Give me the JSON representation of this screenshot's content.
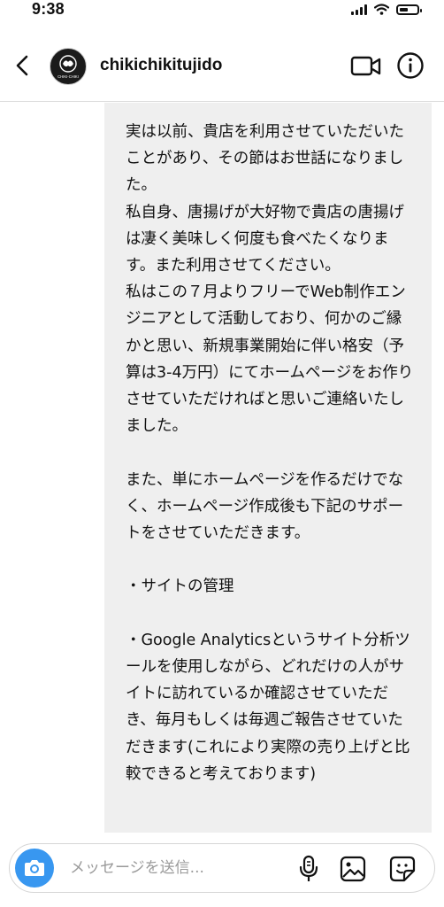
{
  "status_bar": {
    "time": "9:38"
  },
  "header": {
    "username": "chikichikitujido",
    "avatar_text": "CHIKI-CHIKI"
  },
  "message": {
    "text": "実は以前、貴店を利用させていただいたことがあり、その節はお世話になりました。\n私自身、唐揚げが大好物で貴店の唐揚げは凄く美味しく何度も食べたくなります。また利用させてください。\n私はこの７月よりフリーでWeb制作エンジニアとして活動しており、何かのご縁かと思い、新規事業開始に伴い格安（予算は3-4万円）にてホームページをお作りさせていただければと思いご連絡いたしました。\n\nまた、単にホームページを作るだけでなく、ホームページ作成後も下記のサポートをさせていただきます。\n\n・サイトの管理\n\n・Google Analyticsというサイト分析ツールを使用しながら、どれだけの人がサイトに訪れているか確認させていただき、毎月もしくは毎週ご報告させていただきます(これにより実際の売り上げと比較できると考えております)"
  },
  "composer": {
    "placeholder": "メッセージを送信..."
  },
  "colors": {
    "bubble": "#efefef",
    "camera_button": "#3897f0"
  }
}
